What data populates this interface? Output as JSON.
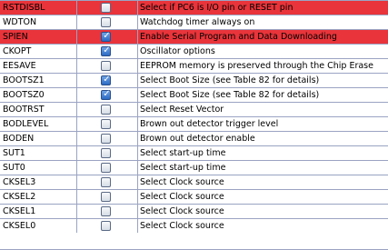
{
  "colors": {
    "highlight": "#e8343a",
    "grid": "#9aa3c3",
    "checked": "#2c6ac3"
  },
  "icons": {
    "checked": "checkmark-icon"
  },
  "fuses": [
    {
      "name": "RSTDISBL",
      "checked": false,
      "highlight": true,
      "description": "Select if PC6 is I/O pin or RESET pin"
    },
    {
      "name": "WDTON",
      "checked": false,
      "highlight": false,
      "description": "Watchdog timer always on"
    },
    {
      "name": "SPIEN",
      "checked": true,
      "highlight": true,
      "description": "Enable Serial Program and Data Downloading"
    },
    {
      "name": "CKOPT",
      "checked": true,
      "highlight": false,
      "description": "Oscillator options"
    },
    {
      "name": "EESAVE",
      "checked": false,
      "highlight": false,
      "description": "EEPROM memory is preserved through the Chip Erase"
    },
    {
      "name": "BOOTSZ1",
      "checked": true,
      "highlight": false,
      "description": "Select Boot Size (see Table 82 for details)"
    },
    {
      "name": "BOOTSZ0",
      "checked": true,
      "highlight": false,
      "description": "Select Boot Size (see Table 82 for details)"
    },
    {
      "name": "BOOTRST",
      "checked": false,
      "highlight": false,
      "description": "Select Reset Vector"
    },
    {
      "name": "BODLEVEL",
      "checked": false,
      "highlight": false,
      "description": "Brown out detector trigger level"
    },
    {
      "name": "BODEN",
      "checked": false,
      "highlight": false,
      "description": "Brown out detector enable"
    },
    {
      "name": "SUT1",
      "checked": false,
      "highlight": false,
      "description": "Select start-up time"
    },
    {
      "name": "SUT0",
      "checked": false,
      "highlight": false,
      "description": "Select start-up time"
    },
    {
      "name": "CKSEL3",
      "checked": false,
      "highlight": false,
      "description": "Select Clock source"
    },
    {
      "name": "CKSEL2",
      "checked": false,
      "highlight": false,
      "description": "Select Clock source"
    },
    {
      "name": "CKSEL1",
      "checked": false,
      "highlight": false,
      "description": "Select Clock source"
    },
    {
      "name": "CKSEL0",
      "checked": false,
      "highlight": false,
      "description": "Select Clock source"
    }
  ]
}
